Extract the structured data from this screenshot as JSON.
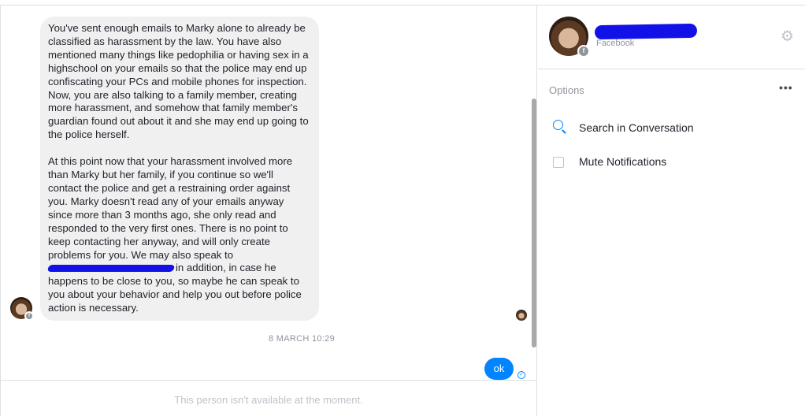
{
  "conversation": {
    "message_paragraph_1": "You've sent enough emails to Marky alone to already be classified as harassment by the law. You have also mentioned many things like pedophilia or having sex in a highschool on your emails so that the police may end up confiscating your PCs and mobile phones for inspection. Now, you are also talking to a family member, creating more harassment, and somehow that family member's guardian found out about it and she may end up going to the police herself.",
    "message_paragraph_2_before": "At this point now that your harassment involved more than Marky but her family, if you continue so we'll contact the police and get a restraining order against you. Marky doesn't read any of your emails anyway since more than 3 months ago, she only read and responded to the very first ones. There is no point to keep contacting her anyway, and will only create problems for you. We may also speak to",
    "message_paragraph_2_after": "in addition, in case he happens to be close to you, so maybe he can speak to you about your behavior and help you out before police action is necessary.",
    "timestamp": "8 MARCH 10:29",
    "sent_message": "ok",
    "unavailable_notice": "This person isn't available at the moment."
  },
  "sidebar": {
    "source": "Facebook",
    "options_label": "Options",
    "more_glyph": "•••",
    "items": [
      {
        "label": "Search in Conversation",
        "icon": "search-icon"
      },
      {
        "label": "Mute Notifications",
        "icon": "checkbox-icon"
      }
    ]
  },
  "colors": {
    "accent": "#0084ff",
    "bubble_gray": "#f1f0f0",
    "redaction": "#1212e8"
  }
}
